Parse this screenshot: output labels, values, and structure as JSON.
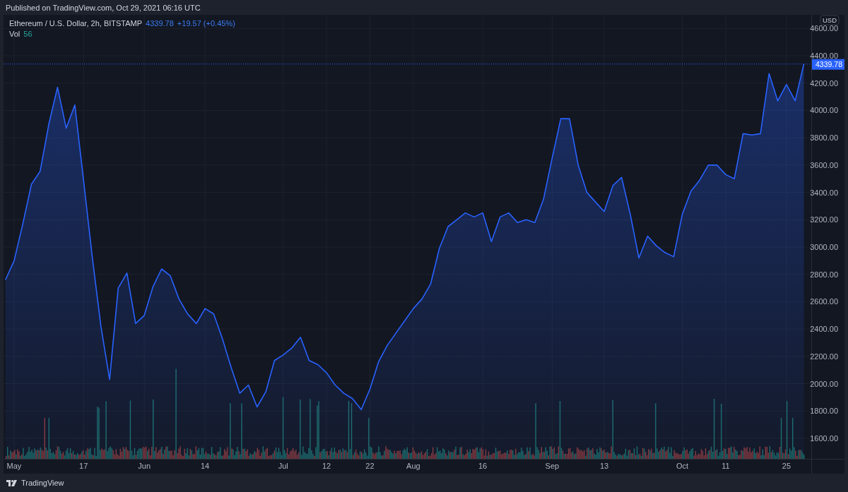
{
  "header": {
    "published": "Published on TradingView.com, Oct 29, 2021 06:16 UTC"
  },
  "legend": {
    "symbol": "Ethereum / U.S. Dollar, 2h, BITSTAMP",
    "price": "4339.78",
    "change": "+19.57 (+0.45%)",
    "volume_label": "Vol",
    "volume_value": "56"
  },
  "price_scale": {
    "currency": "USD",
    "last_price_label": "4339.78"
  },
  "chart_data": {
    "type": "area",
    "grid": true,
    "ylim": [
      1450,
      4700
    ],
    "ref_lines": [
      {
        "axis": "y",
        "value": 4339.78,
        "color": "#2962ff"
      }
    ],
    "categories": [
      null,
      "May",
      null,
      null,
      null,
      null,
      null,
      null,
      null,
      "17",
      null,
      null,
      null,
      null,
      null,
      null,
      "Jun",
      null,
      null,
      null,
      null,
      null,
      null,
      "14",
      null,
      null,
      null,
      null,
      null,
      null,
      null,
      null,
      "Jul",
      null,
      null,
      null,
      null,
      "12",
      null,
      null,
      null,
      null,
      "22",
      null,
      null,
      null,
      null,
      "Aug",
      null,
      null,
      null,
      null,
      null,
      null,
      null,
      "16",
      null,
      null,
      null,
      null,
      null,
      null,
      null,
      "Sep",
      null,
      null,
      null,
      null,
      null,
      "13",
      null,
      null,
      null,
      null,
      null,
      null,
      null,
      null,
      "Oct",
      null,
      null,
      null,
      null,
      "11",
      null,
      null,
      null,
      null,
      null,
      null,
      "25",
      null,
      null
    ],
    "series": [
      {
        "color": "#2962ff",
        "values": [
          2760,
          2900,
          3170,
          3460,
          3555,
          3900,
          4170,
          3870,
          4040,
          3490,
          2930,
          2420,
          2030,
          2700,
          2810,
          2440,
          2500,
          2710,
          2840,
          2790,
          2620,
          2510,
          2440,
          2550,
          2510,
          2330,
          2120,
          1930,
          1990,
          1830,
          1940,
          2170,
          2210,
          2260,
          2340,
          2170,
          2140,
          2080,
          1990,
          1930,
          1890,
          1810,
          1960,
          2160,
          2280,
          2370,
          2460,
          2550,
          2620,
          2730,
          2990,
          3150,
          3200,
          3250,
          3220,
          3250,
          3040,
          3220,
          3250,
          3180,
          3200,
          3180,
          3350,
          3650,
          3940,
          3940,
          3600,
          3400,
          3330,
          3260,
          3450,
          3510,
          3240,
          2920,
          3080,
          3010,
          2960,
          2930,
          3240,
          3410,
          3490,
          3600,
          3600,
          3530,
          3500,
          3830,
          3820,
          3830,
          4270,
          4070,
          4190,
          4070,
          4340
        ]
      }
    ],
    "yticks": [
      {
        "value": 1600,
        "label": "1600.00"
      },
      {
        "value": 1800,
        "label": "1800.00"
      },
      {
        "value": 2000,
        "label": "2000.00"
      },
      {
        "value": 2200,
        "label": "2200.00"
      },
      {
        "value": 2400,
        "label": "2400.00"
      },
      {
        "value": 2600,
        "label": "2600.00"
      },
      {
        "value": 2800,
        "label": "2800.00"
      },
      {
        "value": 3000,
        "label": "3000.00"
      },
      {
        "value": 3200,
        "label": "3200.00"
      },
      {
        "value": 3400,
        "label": "3400.00"
      },
      {
        "value": 3600,
        "label": "3600.00"
      },
      {
        "value": 3800,
        "label": "3800.00"
      },
      {
        "value": 4000,
        "label": "4000.00"
      },
      {
        "value": 4200,
        "label": "4200.00"
      },
      {
        "value": 4400,
        "label": "4400.00"
      },
      {
        "value": 4600,
        "label": "4600.00"
      }
    ]
  },
  "footer": {
    "logo_text": "TradingView"
  }
}
